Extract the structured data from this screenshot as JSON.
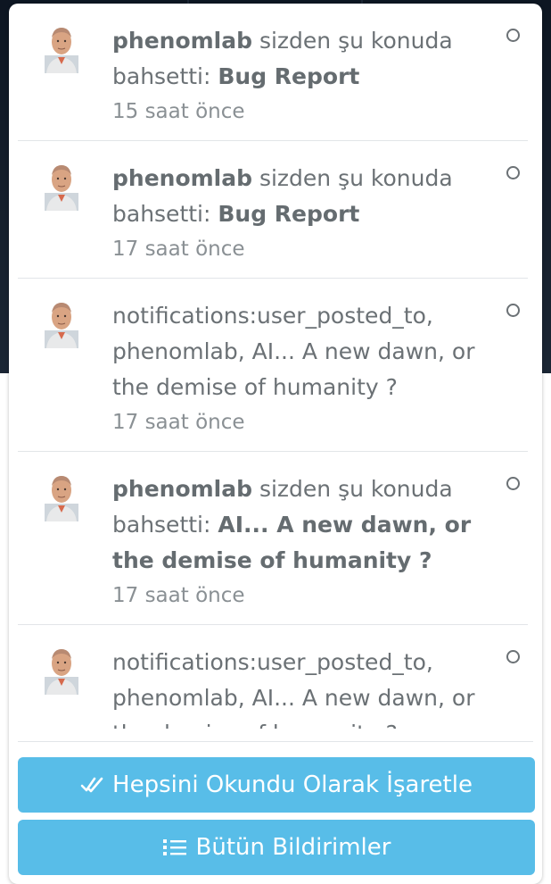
{
  "notifications": [
    {
      "actor": "phenomlab",
      "message": " sizden şu konuda bahsetti: ",
      "topic": "Bug Report",
      "time": "15 saat önce"
    },
    {
      "actor": "phenomlab",
      "message": " sizden şu konuda bahsetti: ",
      "topic": "Bug Report",
      "time": "17 saat önce"
    },
    {
      "text": "notifications:user_posted_to, phenomlab, AI... A new dawn, or the demise of humanity ?",
      "time": "17 saat önce"
    },
    {
      "actor": "phenomlab",
      "message": " sizden şu konuda bahsetti: ",
      "topic": "AI... A new dawn, or the demise of humanity ?",
      "time": "17 saat önce"
    },
    {
      "text": "notifications:user_posted_to, phenomlab, AI... A new dawn, or the demise of humanity ?"
    }
  ],
  "buttons": {
    "mark_all_read": "Hepsini Okundu Olarak İşaretle",
    "all_notifications": "Bütün Bildirimler"
  },
  "colors": {
    "button": "#58bde8",
    "text": "#6b7175"
  },
  "icons": {
    "mark_all_read": "check-double-icon",
    "all_notifications": "list-icon",
    "unread_marker": "circle-outline-icon"
  }
}
